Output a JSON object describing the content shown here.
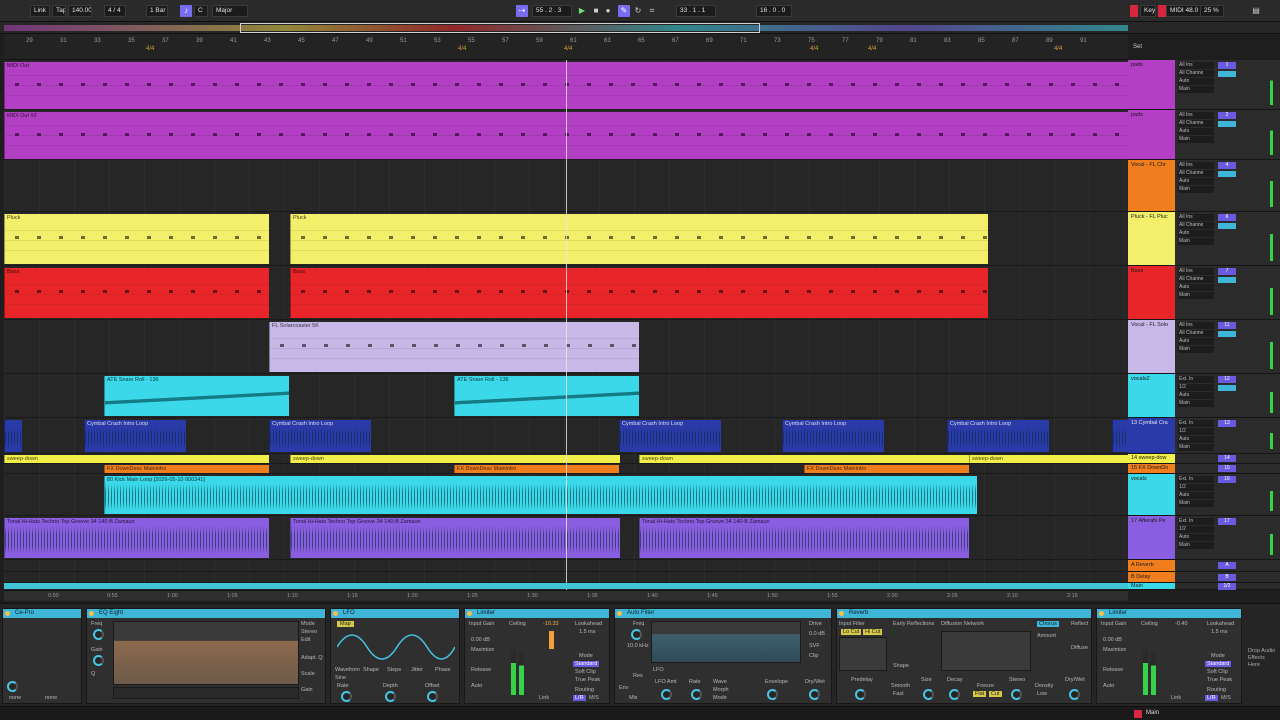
{
  "transport": {
    "link": "Link",
    "tap": "Tap",
    "tempo": "140.00",
    "time_sig": "4 / 4",
    "quantize": "1 Bar",
    "scale_root": "C",
    "scale_mode": "Major",
    "position": "55 . 2 . 3",
    "loop_start": "33 . 1 . 1",
    "loop_length": "16 . 0 . 0",
    "key_label": "Key",
    "midi_label": "MIDI",
    "cpu": "48.0 kHz",
    "zoom": "25 %"
  },
  "ruler": {
    "bars": [
      "29",
      "31",
      "33",
      "35",
      "37",
      "39",
      "41",
      "43",
      "45",
      "47",
      "49",
      "51",
      "53",
      "55",
      "57",
      "59",
      "61",
      "63",
      "65",
      "67",
      "69",
      "71",
      "73",
      "75",
      "77",
      "79",
      "81",
      "83",
      "85",
      "87",
      "89",
      "91"
    ],
    "signatures": [
      "4/4",
      "4/4",
      "4/4",
      "4/4",
      "4/4",
      "4/4"
    ],
    "set_label": "Set"
  },
  "tracks": [
    {
      "name": "pads",
      "color": "#b33fc4",
      "in": "All Ins",
      "ch": "All Channe",
      "mon": "Auto",
      "out": "Main",
      "num": "1"
    },
    {
      "name": "pads",
      "color": "#b33fc4",
      "in": "All Ins",
      "ch": "All Channe",
      "mon": "Auto",
      "out": "Main",
      "num": "2"
    },
    {
      "name": "Vocal - FL Chr",
      "color": "#f07e1e",
      "in": "All Ins",
      "ch": "All Channe",
      "mon": "Auto",
      "out": "Main",
      "num": "4"
    },
    {
      "name": "Pluck - FL Pluc",
      "color": "#f3ef6a",
      "in": "All Ins",
      "ch": "All Channe",
      "mon": "Auto",
      "out": "Main",
      "num": "6"
    },
    {
      "name": "Bass",
      "color": "#e8262a",
      "in": "All Ins",
      "ch": "All Channe",
      "mon": "Auto",
      "out": "Main",
      "num": "7"
    },
    {
      "name": "Vocal - FL Solo",
      "color": "#c8b8e8",
      "in": "All Ins",
      "ch": "All Channe",
      "mon": "Auto",
      "out": "Main",
      "num": "11"
    },
    {
      "name": "vocals2",
      "color": "#3ad8e8",
      "in": "Ext. In",
      "ch": "1/2",
      "mon": "Auto",
      "out": "Main",
      "num": "12"
    },
    {
      "name": "13 Cymbal Cra",
      "color": "#2a3aa8",
      "in": "Ext. In",
      "ch": "1/2",
      "mon": "Auto",
      "out": "Main",
      "num": "13"
    },
    {
      "name": "14 sweep-dow",
      "color": "#f3ef4a",
      "in": "",
      "ch": "",
      "mon": "",
      "out": "",
      "num": "14"
    },
    {
      "name": "15 FX DownDo",
      "color": "#f07e1e",
      "in": "",
      "ch": "",
      "mon": "",
      "out": "",
      "num": "15"
    },
    {
      "name": "vocals",
      "color": "#3ad8e8",
      "in": "Ext. In",
      "ch": "1/2",
      "mon": "Auto",
      "out": "Main",
      "num": "16"
    },
    {
      "name": "17 Afterafs Pe",
      "color": "#8a5ee0",
      "in": "Ext. In",
      "ch": "1/2",
      "mon": "Auto",
      "out": "Main",
      "num": "17"
    },
    {
      "name": "A Reverb",
      "color": "#f07e1e",
      "in": "",
      "ch": "",
      "mon": "",
      "out": "",
      "num": "A"
    },
    {
      "name": "B Delay",
      "color": "#f07e1e",
      "in": "",
      "ch": "",
      "mon": "",
      "out": "",
      "num": "B"
    },
    {
      "name": "Main",
      "color": "#3ad8e8",
      "in": "",
      "ch": "",
      "mon": "",
      "out": "",
      "num": "1/2"
    }
  ],
  "clips": {
    "midi_out": "MIDI Out",
    "midi_out2": "MIDI Out #2",
    "pluck": "Pluck",
    "bass": "Bass",
    "solo": "FL Solarcoaster 5K",
    "snare": "ATE Snare Roll - 136",
    "cymbal": "Cymbal Crash Intro Loop",
    "sweep": "sweep-down",
    "fx": "FX DownDesc Mainintro",
    "kick": "80 Kick Main Loop [2026-05-10 000341]",
    "tonal": "Tonal Hi-Hats Techno Top Groove 34 140-B Zamaun"
  },
  "timeline": [
    "0:50",
    "0:55",
    "1:00",
    "1:05",
    "1:10",
    "1:15",
    "1:20",
    "1:25",
    "1:30",
    "1:35",
    "1:40",
    "1:45",
    "1:50",
    "1:55",
    "2:00",
    "2:05",
    "2:10",
    "2:15"
  ],
  "devices": [
    {
      "name": "Ce-Pro",
      "labels": [
        "none",
        "none"
      ]
    },
    {
      "name": "EQ Eight",
      "labels": [
        "Freq",
        "Gain",
        "Q",
        "Mode",
        "Stereo",
        "Edit",
        "Adapt. Q",
        "Scale",
        "Gain"
      ]
    },
    {
      "name": "LFO",
      "labels": [
        "Map",
        "Waveform",
        "Shape",
        "Steps",
        "Jitter",
        "Phase",
        "Rate",
        "Depth",
        "Offset",
        "Sine"
      ]
    },
    {
      "name": "Limiter",
      "labels": [
        "Input Gain",
        "Ceiling",
        "Lookahead",
        "Maximize",
        "Release",
        "Auto",
        "Link",
        "Mode",
        "Standard",
        "Soft Clip",
        "True Peak",
        "Routing",
        "L/R",
        "M/S",
        "0.00 dB",
        "-10.33",
        "1.5 ms"
      ]
    },
    {
      "name": "Auto Filter",
      "labels": [
        "Freq",
        "Res",
        "Drive",
        "SVF",
        "Clip",
        "Env",
        "LFO",
        "Mix",
        "Envelope",
        "Dry/Wet",
        "LFO Amt",
        "Rate",
        "Wave",
        "Morph",
        "Mode",
        "10.0 kHz",
        "0.0 dB"
      ]
    },
    {
      "name": "Reverb",
      "labels": [
        "Input Filter",
        "Early Reflections",
        "Diffusion Network",
        "Chorus",
        "Reflect",
        "Diffuse",
        "Predelay",
        "Smooth",
        "Size",
        "Decay",
        "Freeze",
        "Stereo",
        "Density",
        "Dry/Wet",
        "Lo Cut",
        "Hi Cut",
        "Shape",
        "Amount",
        "Flat",
        "Cut",
        "Fast",
        "Low"
      ]
    },
    {
      "name": "Limiter",
      "labels": [
        "Input Gain",
        "Ceiling",
        "Lookahead",
        "Maximize",
        "Release",
        "Auto",
        "Link",
        "Mode",
        "Standard",
        "Soft Clip",
        "True Peak",
        "Routing",
        "L/R",
        "M/S",
        "0.00 dB",
        "-0.40",
        "1.5 ms"
      ]
    }
  ],
  "dropzone": "Drop Audio Effects Here",
  "status": {
    "main": "Main"
  }
}
